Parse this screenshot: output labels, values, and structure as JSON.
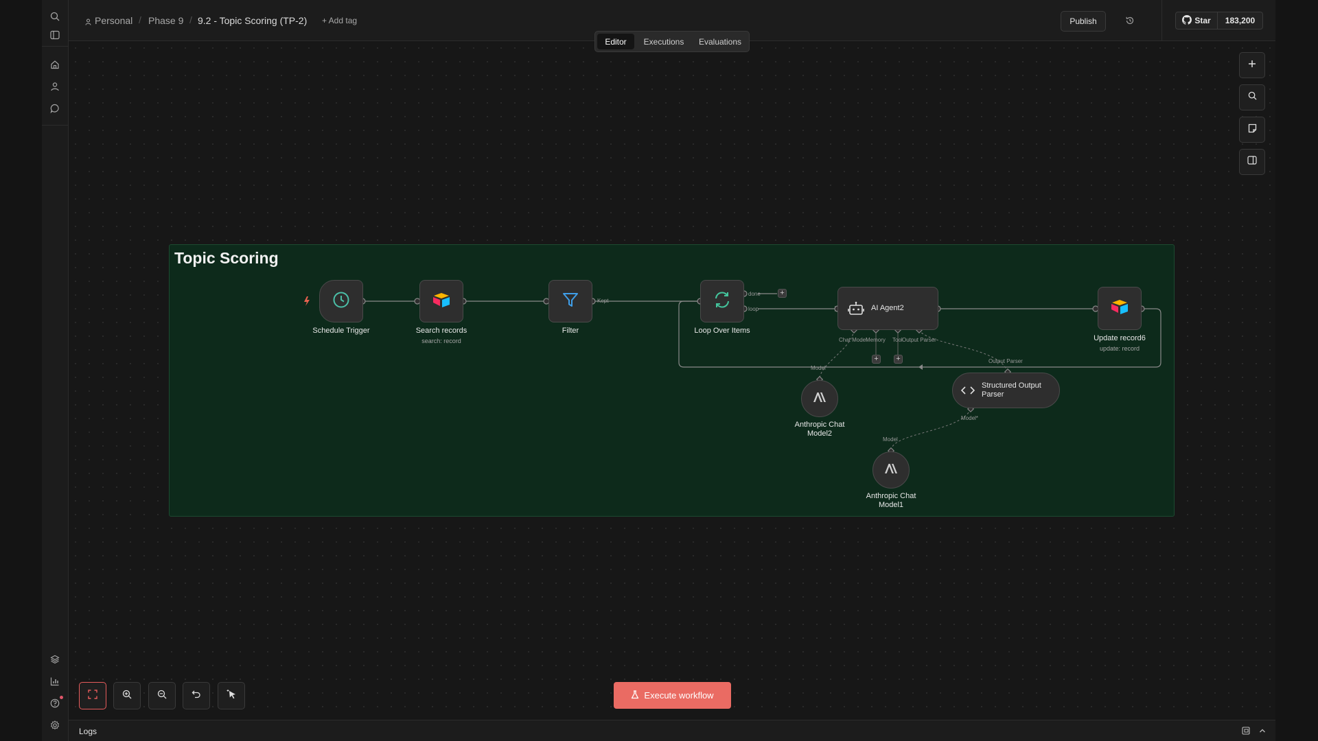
{
  "breadcrumbs": {
    "owner": "Personal",
    "folder": "Phase 9",
    "workflow": "9.2 - Topic Scoring (TP-2)",
    "add_tag": "+ Add tag"
  },
  "header": {
    "publish_label": "Publish",
    "github_star_label": "Star",
    "github_star_count": "183,200"
  },
  "tabs": [
    "Editor",
    "Executions",
    "Evaluations"
  ],
  "active_tab": "Editor",
  "sticky_note": {
    "title": "Topic Scoring"
  },
  "nodes": {
    "schedule_trigger": {
      "label": "Schedule Trigger",
      "icon": "clock-icon"
    },
    "search_records": {
      "label": "Search records",
      "subtitle": "search: record",
      "icon": "airtable-icon"
    },
    "filter": {
      "label": "Filter",
      "icon": "filter-icon"
    },
    "loop": {
      "label": "Loop Over Items",
      "icon": "refresh-icon"
    },
    "ai_agent": {
      "label": "AI Agent2",
      "icon": "robot-icon"
    },
    "update_record": {
      "label": "Update record6",
      "subtitle": "update: record",
      "icon": "airtable-icon"
    },
    "anthropic2": {
      "label": "Anthropic Chat Model2",
      "icon": "anthropic-icon"
    },
    "output_parser": {
      "label": "Structured Output Parser",
      "icon": "code-icon"
    },
    "anthropic1": {
      "label": "Anthropic Chat Model1",
      "icon": "anthropic-icon"
    }
  },
  "connection_labels": {
    "kept": "Kept",
    "done": "done",
    "loop": "loop",
    "chat_model": "Chat Model",
    "memory": "Memory",
    "tool": "Tool",
    "output_parser_port": "Output Parser",
    "output_parser_in": "Output Parser",
    "model": "Model",
    "model_required": "Model*",
    "model_in": "Model"
  },
  "execute_label": "Execute workflow",
  "logs_label": "Logs",
  "colors": {
    "accent": "#ea6b63",
    "sticky_bg": "#0d2a1b",
    "node_bg": "#2e2e2e"
  }
}
